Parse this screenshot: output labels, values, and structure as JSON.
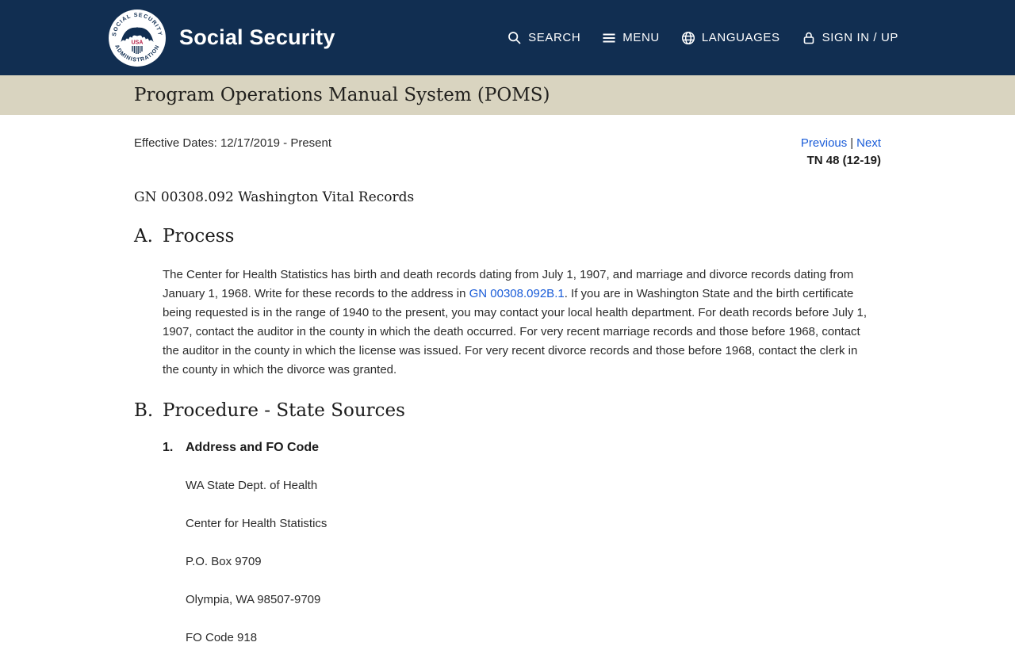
{
  "theme": {
    "header_bg": "#112e51",
    "banner_bg": "#d9d4c0",
    "link_color": "#1a5cd8",
    "seal_red": "#b31942"
  },
  "header": {
    "brand": "Social Security",
    "seal_icon": "ssa-seal",
    "nav": [
      {
        "label": "SEARCH",
        "icon": "search-icon"
      },
      {
        "label": "MENU",
        "icon": "menu-icon"
      },
      {
        "label": "LANGUAGES",
        "icon": "globe-icon"
      },
      {
        "label": "SIGN IN / UP",
        "icon": "lock-icon"
      }
    ]
  },
  "banner": {
    "title": "Program Operations Manual System (POMS)"
  },
  "meta": {
    "effective_dates": "Effective Dates: 12/17/2019 - Present",
    "previous_label": "Previous",
    "separator": "|",
    "next_label": "Next",
    "transmittal": "TN 48 (12-19)"
  },
  "document": {
    "title": "GN 00308.092 Washington Vital Records",
    "section_a": {
      "letter": "A.",
      "heading": "Process",
      "paragraph_before_link": "The Center for Health Statistics has birth and death records dating from July 1, 1907, and marriage and divorce records dating from January 1, 1968. Write for these records to the address in ",
      "link_text": "GN 00308.092B.1",
      "paragraph_after_link": ". If you are in Washington State and the birth certificate being requested is in the range of 1940 to the present, you may contact your local health department. For death records before July 1, 1907, contact the auditor in the county in which the death occurred. For very recent marriage records and those before 1968, contact the auditor in the county in which the license was issued. For very recent divorce records and those before 1968, contact the clerk in the county in which the divorce was granted."
    },
    "section_b": {
      "letter": "B.",
      "heading": "Procedure - State Sources",
      "sub_number": "1.",
      "sub_heading": "Address and FO Code",
      "address_lines": [
        "WA State Dept. of Health",
        "Center for Health Statistics",
        "P.O. Box 9709",
        "Olympia, WA 98507-9709",
        "FO Code 918"
      ]
    }
  }
}
